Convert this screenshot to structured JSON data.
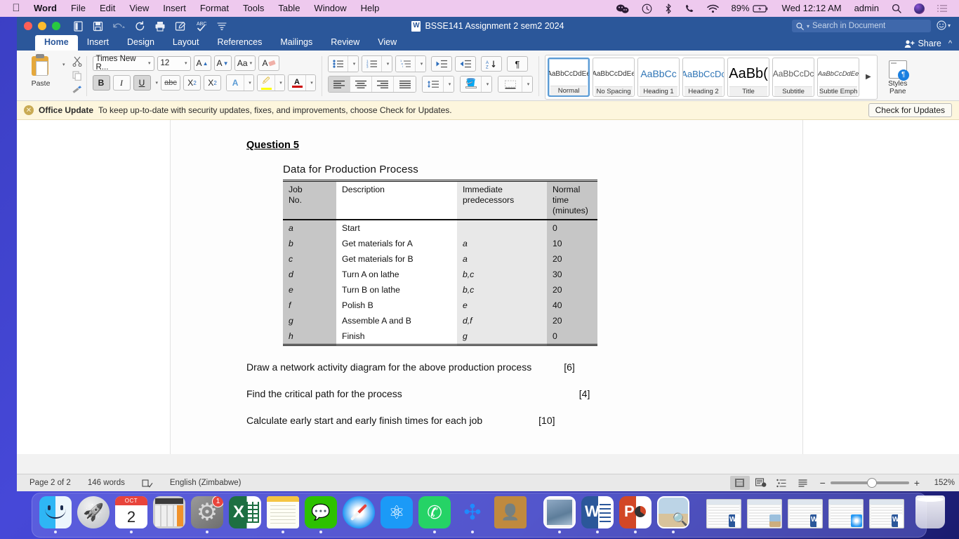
{
  "menubar": {
    "apple": "",
    "app_name": "Word",
    "items": [
      "File",
      "Edit",
      "View",
      "Insert",
      "Format",
      "Tools",
      "Table",
      "Window",
      "Help"
    ],
    "status": {
      "battery": "89%",
      "clock": "Wed 12:12 AM",
      "user": "admin"
    },
    "icons": [
      "wechat-status-icon",
      "time-machine-icon",
      "bluetooth-icon",
      "phone-icon",
      "wifi-icon",
      "battery-charging-icon",
      "spotlight-search-icon",
      "user-avatar-icon",
      "control-center-icon"
    ]
  },
  "titlebar": {
    "document_title": "BSSE141 Assignment 2 sem2 2024",
    "search_placeholder": "Search in Document",
    "quick_access": [
      "new-document-icon",
      "save-icon",
      "undo-icon",
      "redo-icon",
      "print-icon",
      "track-changes-icon",
      "spelling-icon",
      "customize-toolbar-icon"
    ]
  },
  "ribbon": {
    "tabs": [
      {
        "label": "Home",
        "active": true
      },
      {
        "label": "Insert",
        "active": false
      },
      {
        "label": "Design",
        "active": false
      },
      {
        "label": "Layout",
        "active": false
      },
      {
        "label": "References",
        "active": false
      },
      {
        "label": "Mailings",
        "active": false
      },
      {
        "label": "Review",
        "active": false
      },
      {
        "label": "View",
        "active": false
      }
    ],
    "share_label": "Share",
    "clipboard": {
      "paste_label": "Paste",
      "cut_icon": "scissors-icon",
      "copy_icon": "copy-icon",
      "format_painter_icon": "format-painter-icon"
    },
    "font": {
      "family_value": "Times New R...",
      "size_value": "12",
      "grow_label": "A",
      "shrink_label": "A",
      "change_case_label": "Aa",
      "clear_format_label": "A",
      "bold_label": "B",
      "italic_label": "I",
      "underline_label": "U",
      "strikethrough_label": "abc",
      "subscript_label": "X",
      "subscript_sub": "2",
      "superscript_label": "X",
      "superscript_sup": "2",
      "text_effects_label": "A",
      "highlight_label": "A",
      "font_color_label": "A"
    },
    "paragraph": {
      "bullets_icon": "bullet-list-icon",
      "numbering_icon": "numbered-list-icon",
      "multilevel_icon": "multilevel-list-icon",
      "decrease_indent_icon": "decrease-indent-icon",
      "increase_indent_icon": "increase-indent-icon",
      "sort_icon": "sort-az-icon",
      "show_marks_label": "¶",
      "align_left_icon": "align-left-icon",
      "align_center_icon": "align-center-icon",
      "align_right_icon": "align-right-icon",
      "justify_icon": "justify-icon",
      "line_spacing_icon": "line-spacing-icon",
      "shading_icon": "shading-icon",
      "borders_icon": "borders-icon"
    },
    "styles": [
      {
        "preview": "AaBbCcDdEe",
        "name": "Normal",
        "cls": "p-normal",
        "active": true
      },
      {
        "preview": "AaBbCcDdEe",
        "name": "No Spacing",
        "cls": "p-normal",
        "active": false
      },
      {
        "preview": "AaBbCc",
        "name": "Heading 1",
        "cls": "p-h1",
        "active": false
      },
      {
        "preview": "AaBbCcDc",
        "name": "Heading 2",
        "cls": "p-h2",
        "active": false
      },
      {
        "preview": "AaBb(",
        "name": "Title",
        "cls": "p-title",
        "active": false
      },
      {
        "preview": "AaBbCcDc",
        "name": "Subtitle",
        "cls": "p-sub",
        "active": false
      },
      {
        "preview": "AaBbCcDdEe",
        "name": "Subtle Emph...",
        "cls": "p-emph",
        "active": false
      }
    ],
    "styles_pane_label_line1": "Styles",
    "styles_pane_label_line2": "Pane",
    "styles_pane_badge": "¶"
  },
  "notification": {
    "title": "Office Update",
    "message": "To keep up-to-date with security updates, fixes, and improvements, choose Check for Updates.",
    "button": "Check for Updates",
    "close_icon": "close-circle-icon"
  },
  "document": {
    "question_heading": "Question 5",
    "table_caption": "Data for Production Process",
    "table": {
      "headers": [
        "Job\nNo.",
        "Description",
        "Immediate\npredecessors",
        "Normal\ntime\n(minutes)"
      ],
      "header_job_line1": "Job",
      "header_job_line2": "No.",
      "header_description": "Description",
      "header_pred_line1": "Immediate",
      "header_pred_line2": "predecessors",
      "header_time_line1": "Normal",
      "header_time_line2": "time",
      "header_time_line3": "(minutes)",
      "rows": [
        {
          "job": "a",
          "description": "Start",
          "predecessors": "",
          "time": "0"
        },
        {
          "job": "b",
          "description": "Get materials for A",
          "predecessors": "a",
          "time": "10"
        },
        {
          "job": "c",
          "description": "Get materials for B",
          "predecessors": "a",
          "time": "20"
        },
        {
          "job": "d",
          "description": "Turn A on lathe",
          "predecessors": "b,c",
          "time": "30"
        },
        {
          "job": "e",
          "description": "Turn B on lathe",
          "predecessors": "b,c",
          "time": "20"
        },
        {
          "job": "f",
          "description": "Polish B",
          "predecessors": "e",
          "time": "40"
        },
        {
          "job": "g",
          "description": "Assemble A and B",
          "predecessors": "d,f",
          "time": "20"
        },
        {
          "job": "h",
          "description": "Finish",
          "predecessors": "g",
          "time": "0"
        }
      ]
    },
    "questions": [
      {
        "text": "Draw a network activity diagram for the above production process",
        "marks": "[6]"
      },
      {
        "text": "Find the critical path for the process",
        "marks": "[4]"
      },
      {
        "text": "Calculate early start and early finish times for each job",
        "marks": "[10]"
      }
    ]
  },
  "statusbar": {
    "page": "Page 2 of 2",
    "words": "146 words",
    "proofing_icon": "proofing-check-icon",
    "language": "English (Zimbabwe)",
    "views": [
      "print-layout-icon",
      "web-layout-icon",
      "outline-icon",
      "draft-icon"
    ],
    "zoom_minus": "−",
    "zoom_plus": "+",
    "zoom_value": "152%"
  },
  "dock": {
    "items": [
      {
        "name": "finder",
        "cls": "ic-finder",
        "running": true
      },
      {
        "name": "launchpad",
        "cls": "ic-launch",
        "running": false
      },
      {
        "name": "calendar",
        "cls": "ic-cal",
        "running": true,
        "month": "OCT",
        "day": "2"
      },
      {
        "name": "calculator",
        "cls": "ic-calc",
        "running": false
      },
      {
        "name": "system-preferences",
        "cls": "ic-sysprefs",
        "running": true,
        "badge": "1"
      },
      {
        "name": "microsoft-excel",
        "cls": "ic-excel",
        "running": false
      },
      {
        "name": "notes",
        "cls": "ic-notes",
        "running": true
      },
      {
        "name": "wechat",
        "cls": "ic-wechat",
        "running": true
      },
      {
        "name": "safari",
        "cls": "ic-safari",
        "running": false
      },
      {
        "name": "shareit",
        "cls": "ic-share",
        "running": false
      },
      {
        "name": "whatsapp",
        "cls": "ic-wa",
        "running": true
      },
      {
        "name": "bluetooth",
        "cls": "ic-bt",
        "running": true
      },
      {
        "name": "contacts",
        "cls": "ic-contacts",
        "running": false
      },
      {
        "name": "mail",
        "cls": "ic-mail",
        "running": true,
        "separator_before": true
      },
      {
        "name": "microsoft-word",
        "cls": "ic-word",
        "running": true
      },
      {
        "name": "microsoft-powerpoint",
        "cls": "ic-ppt",
        "running": true
      },
      {
        "name": "photos",
        "cls": "ic-photos",
        "running": true
      }
    ],
    "minimized": [
      {
        "name": "minimized-word-document-1",
        "mini": "mini-word"
      },
      {
        "name": "minimized-word-document-2",
        "mini": "mini-photo"
      },
      {
        "name": "minimized-word-document-3",
        "mini": "mini-word"
      },
      {
        "name": "minimized-safari-window",
        "mini": "mini-safari"
      },
      {
        "name": "minimized-word-document-4",
        "mini": "mini-word"
      }
    ],
    "trash_name": "trash"
  }
}
